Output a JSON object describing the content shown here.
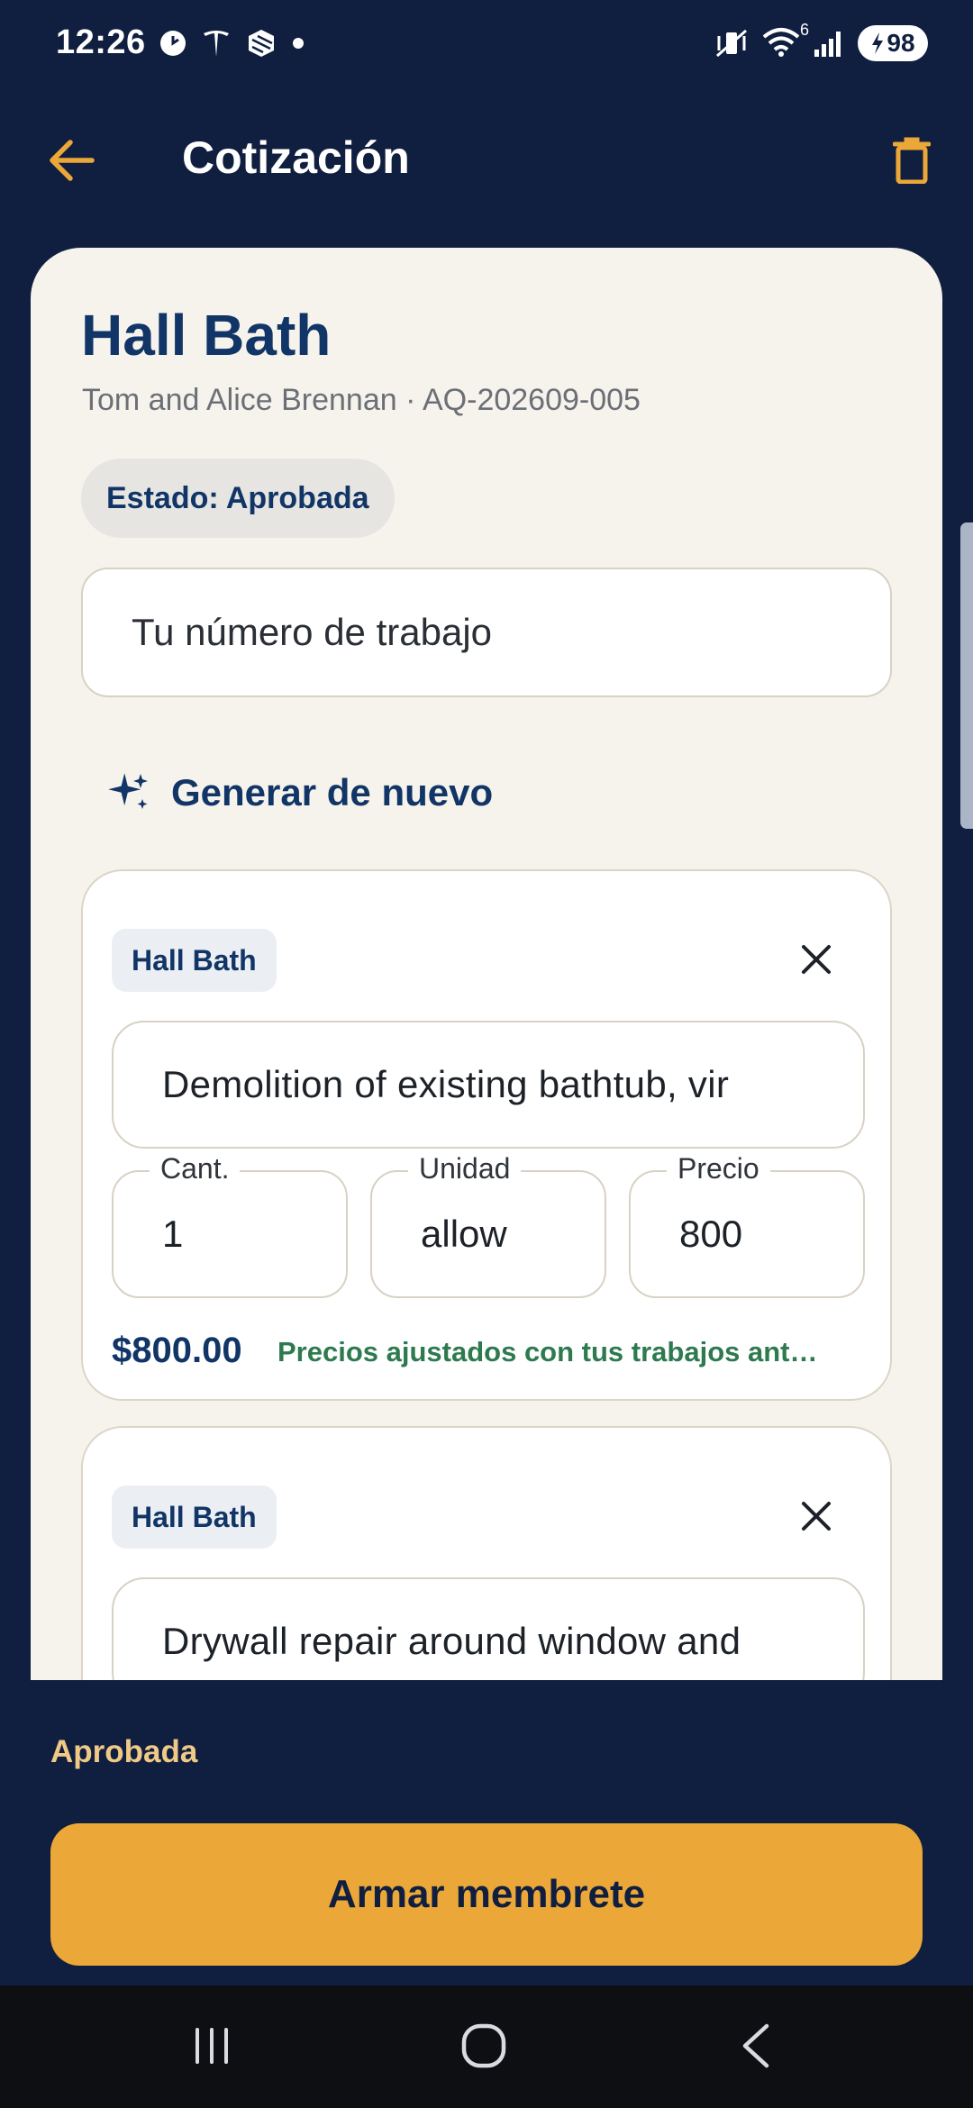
{
  "status_bar": {
    "time": "12:26",
    "battery": "98",
    "wifi_badge": "6"
  },
  "header": {
    "title": "Cotización"
  },
  "quote": {
    "title": "Hall Bath",
    "subtitle": "Tom and Alice Brennan · AQ-202609-005",
    "status_chip": "Estado: Aprobada",
    "job_number_placeholder": "Tu número de trabajo",
    "regenerate_label": "Generar de nuevo"
  },
  "labels": {
    "qty": "Cant.",
    "unit": "Unidad",
    "price": "Precio"
  },
  "line_items": [
    {
      "tag": "Hall Bath",
      "description": "Demolition of existing bathtub, vir",
      "qty": "1",
      "unit": "allow",
      "price": "800",
      "total": "$800.00",
      "note": "Precios ajustados con tus trabajos ant…"
    },
    {
      "tag": "Hall Bath",
      "description": "Drywall repair around window and"
    }
  ],
  "footer": {
    "status_text": "Aprobada",
    "primary_button": "Armar membrete"
  },
  "colors": {
    "background": "#101f40",
    "card": "#f6f3ec",
    "accent": "#eba738",
    "brand_text": "#113566",
    "success_text": "#2e7a4f"
  }
}
